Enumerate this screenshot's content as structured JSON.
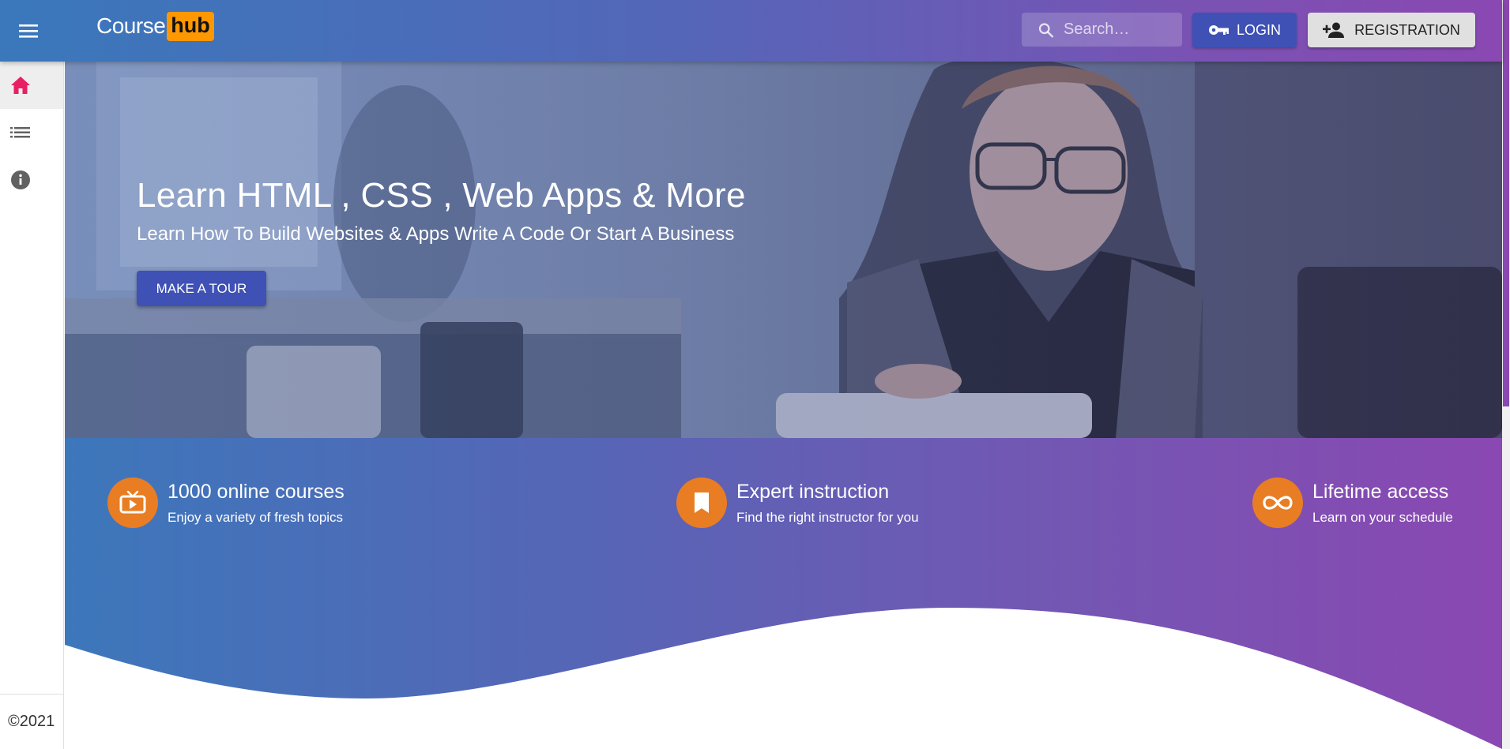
{
  "header": {
    "logo_part1": "Course",
    "logo_part2": "hub",
    "search_placeholder": "Search…",
    "login_label": "LOGIN",
    "registration_label": "REGISTRATION"
  },
  "sidebar": {
    "items": [
      {
        "icon": "home-icon",
        "active": true
      },
      {
        "icon": "list-icon",
        "active": false
      },
      {
        "icon": "info-icon",
        "active": false
      }
    ],
    "copyright": "©2021"
  },
  "hero": {
    "title": "Learn HTML , CSS , Web Apps & More",
    "subtitle": "Learn How To Build Websites & Apps Write A Code Or Start A Business",
    "cta_label": "MAKE A TOUR"
  },
  "features": [
    {
      "icon": "tv-icon",
      "title": "1000 online courses",
      "desc": "Enjoy a variety of fresh topics"
    },
    {
      "icon": "bookmark-icon",
      "title": "Expert instruction",
      "desc": "Find the right instructor for you"
    },
    {
      "icon": "infinity-icon",
      "title": "Lifetime access",
      "desc": "Learn on your schedule"
    }
  ],
  "colors": {
    "accent_orange": "#ff9800",
    "primary": "#3f51b5",
    "active_icon": "#e91e63",
    "gradient_start": "#3a78bb",
    "gradient_end": "#8a48b2"
  }
}
